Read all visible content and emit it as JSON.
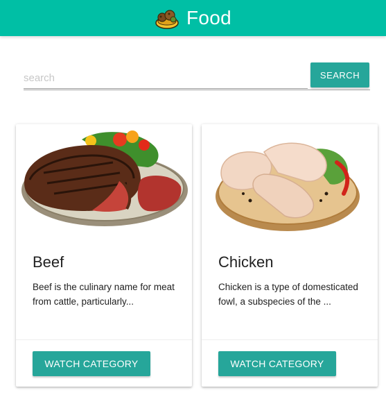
{
  "header": {
    "title": "Food",
    "logo_icon": "food-bowl-icon",
    "background": "#00bfa5"
  },
  "search": {
    "placeholder": "search",
    "value": "",
    "button_label": "SEARCH"
  },
  "categories": [
    {
      "name": "Beef",
      "description": "Beef is the culinary name for meat from cattle, particularly...",
      "button_label": "WATCH CATEGORY",
      "image_icon": "beef-steak-plate-image"
    },
    {
      "name": "Chicken",
      "description": "Chicken is a type of domesticated fowl, a subspecies of the ...",
      "button_label": "WATCH CATEGORY",
      "image_icon": "chicken-legs-board-image"
    }
  ],
  "colors": {
    "accent": "#26a69a",
    "app_bar": "#00bfa5"
  }
}
